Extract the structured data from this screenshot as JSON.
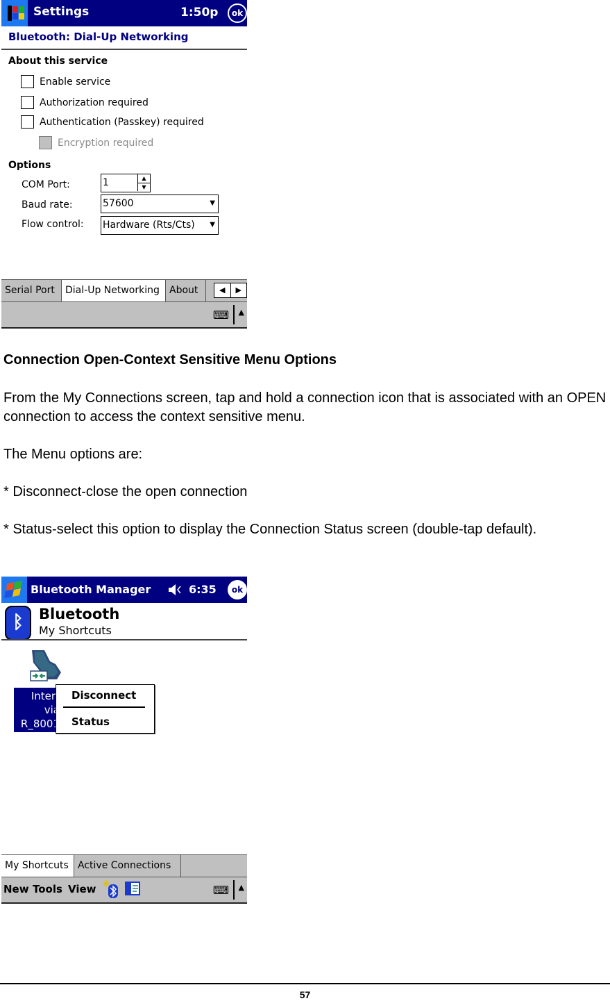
{
  "screen1": {
    "titlebar": {
      "title": "Settings",
      "time": "1:50p",
      "ok_label": "ok"
    },
    "subheader": "Bluetooth: Dial-Up Networking",
    "about_section": {
      "heading": "About this service",
      "checkboxes": [
        {
          "label": "Enable service",
          "checked": false,
          "enabled": true
        },
        {
          "label": "Authorization required",
          "checked": false,
          "enabled": true
        },
        {
          "label": "Authentication (Passkey) required",
          "checked": false,
          "enabled": true
        },
        {
          "label": "Encryption required",
          "checked": false,
          "enabled": false
        }
      ]
    },
    "options_section": {
      "heading": "Options",
      "com_port": {
        "label": "COM Port:",
        "value": "1"
      },
      "baud_rate": {
        "label": "Baud rate:",
        "value": "57600"
      },
      "flow_control": {
        "label": "Flow control:",
        "value": "Hardware (Rts/Cts)"
      }
    },
    "tabs": [
      {
        "label": "Serial Port",
        "active": false
      },
      {
        "label": "Dial-Up Networking",
        "active": true
      },
      {
        "label": "About",
        "active": false
      }
    ],
    "icons": {
      "scroll_left": "◀",
      "scroll_right": "▶",
      "keyboard": "⌨",
      "up": "▲",
      "spin_up": "▲",
      "spin_down": "▼",
      "dropdown": "▼"
    }
  },
  "document": {
    "heading": "Connection Open-Context Sensitive Menu Options",
    "paragraphs": [
      "From the My Connections screen, tap and hold a connection icon that is associated with an OPEN connection to access the context sensitive menu.",
      "The Menu options are:",
      "* Disconnect-close the open connection",
      "* Status-select this option to display the Connection Status screen (double-tap default)."
    ],
    "page_number": "57"
  },
  "screen2": {
    "titlebar": {
      "title": "Bluetooth Manager",
      "speaker_icon": "◀︎",
      "time": "6:35",
      "ok_label": "ok"
    },
    "header": {
      "title": "Bluetooth",
      "subtitle": "My Shortcuts",
      "logo_glyph": "ᛒ"
    },
    "connection": {
      "label_lines": [
        "Interr",
        "via",
        "R_8001"
      ]
    },
    "context_menu": {
      "items": [
        "Disconnect",
        "Status"
      ]
    },
    "tabs": [
      {
        "label": "My Shortcuts",
        "active": true
      },
      {
        "label": "Active Connections",
        "active": false
      }
    ],
    "menubar": {
      "items": [
        "New",
        "Tools",
        "View"
      ]
    }
  }
}
